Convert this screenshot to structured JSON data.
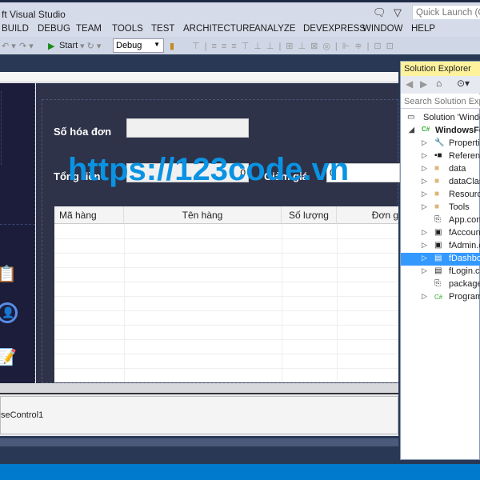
{
  "window": {
    "title": "ft Visual Studio",
    "quick_launch_placeholder": "Quick Launch (Ct"
  },
  "menu": [
    "BUILD",
    "DEBUG",
    "TEAM",
    "TOOLS",
    "TEST",
    "ARCHITECTURE",
    "ANALYZE",
    "DEVEXPRESS",
    "WINDOW",
    "HELP"
  ],
  "toolbar": {
    "start_label": "Start",
    "config": "Debug"
  },
  "form": {
    "invoice_label": "Số hóa đơn",
    "invoice_value": "",
    "total_label": "Tổng tiền",
    "total_value": "0",
    "discount_label": "Giảm giá",
    "discount_value": "0",
    "columns": [
      "Mã hàng",
      "Tên hàng",
      "Số lượng",
      "Đơn g"
    ]
  },
  "tray": {
    "component": "seControl1"
  },
  "watermark": "https://123code.vn",
  "solution_explorer": {
    "title": "Solution Explorer",
    "search_placeholder": "Search Solution Explo",
    "nodes": [
      {
        "label": "Solution 'Windo",
        "icon": "solution-icon"
      },
      {
        "label": "WindowsFo",
        "icon": "csharp-project-icon"
      },
      {
        "label": "Propertie",
        "icon": "wrench-icon"
      },
      {
        "label": "Referenc",
        "icon": "references-icon"
      },
      {
        "label": "data",
        "icon": "folder-icon"
      },
      {
        "label": "dataClas",
        "icon": "folder-icon"
      },
      {
        "label": "Resource",
        "icon": "folder-icon"
      },
      {
        "label": "Tools",
        "icon": "folder-icon"
      },
      {
        "label": "App.conf",
        "icon": "config-icon"
      },
      {
        "label": "fAccount",
        "icon": "form-icon"
      },
      {
        "label": "fAdmin.c",
        "icon": "form-icon"
      },
      {
        "label": "fDashboa",
        "icon": "form-icon"
      },
      {
        "label": "fLogin.cs",
        "icon": "form-icon"
      },
      {
        "label": "packages",
        "icon": "config-icon"
      },
      {
        "label": "Program",
        "icon": "csharp-file-icon"
      }
    ],
    "selected": "fDashboa"
  },
  "colors": {
    "accent": "#007acc",
    "watermark": "#0a93e3",
    "form_bg": "#2e3349",
    "selected": "#3399ff"
  }
}
